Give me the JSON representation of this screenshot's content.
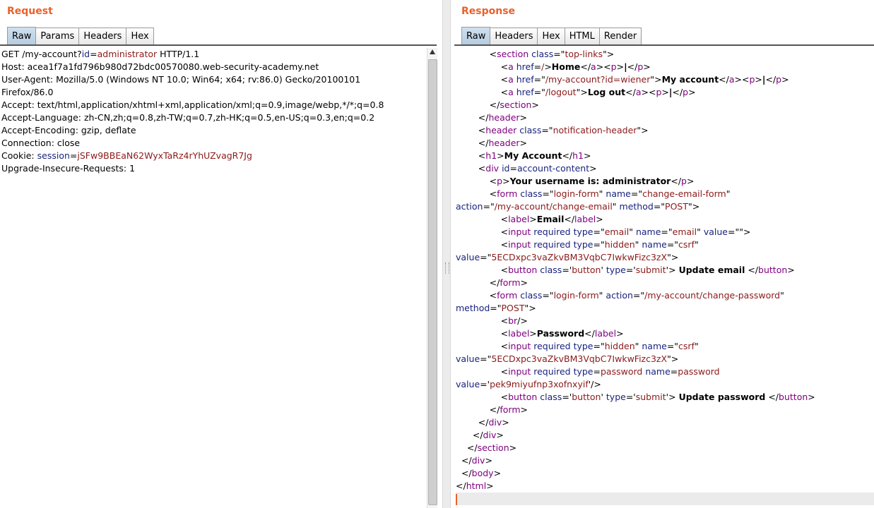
{
  "request": {
    "title": "Request",
    "tabs": [
      "Raw",
      "Params",
      "Headers",
      "Hex"
    ],
    "active_tab": "Raw",
    "lines": [
      [
        {
          "t": "GET /my-account?"
        },
        {
          "t": "id",
          "c": "attr"
        },
        {
          "t": "="
        },
        {
          "t": "administrator",
          "c": "val"
        },
        {
          "t": " HTTP/1.1"
        }
      ],
      [
        {
          "t": "Host: acea1f7a1fd796b980d72bdc00570080.web-security-academy.net"
        }
      ],
      [
        {
          "t": "User-Agent: Mozilla/5.0 (Windows NT 10.0; Win64; x64; rv:86.0) Gecko/20100101"
        }
      ],
      [
        {
          "t": "Firefox/86.0"
        }
      ],
      [
        {
          "t": "Accept: text/html,application/xhtml+xml,application/xml;q=0.9,image/webp,*/*;q=0.8"
        }
      ],
      [
        {
          "t": "Accept-Language: zh-CN,zh;q=0.8,zh-TW;q=0.7,zh-HK;q=0.5,en-US;q=0.3,en;q=0.2"
        }
      ],
      [
        {
          "t": "Accept-Encoding: gzip, deflate"
        }
      ],
      [
        {
          "t": "Connection: close"
        }
      ],
      [
        {
          "t": "Cookie: "
        },
        {
          "t": "session",
          "c": "attr"
        },
        {
          "t": "="
        },
        {
          "t": "jSFw9BBEaN62WyxTaRz4rYhUZvagR7Jg",
          "c": "val"
        }
      ],
      [
        {
          "t": "Upgrade-Insecure-Requests: 1"
        }
      ]
    ]
  },
  "response": {
    "title": "Response",
    "tabs": [
      "Raw",
      "Headers",
      "Hex",
      "HTML",
      "Render"
    ],
    "active_tab": "Raw",
    "lines": [
      [
        {
          "t": "            <"
        },
        {
          "t": "section",
          "c": "tag"
        },
        {
          "t": " "
        },
        {
          "t": "class",
          "c": "attr"
        },
        {
          "t": "=\""
        },
        {
          "t": "top-links",
          "c": "val"
        },
        {
          "t": "\">"
        }
      ],
      [
        {
          "t": "                <"
        },
        {
          "t": "a",
          "c": "tag"
        },
        {
          "t": " "
        },
        {
          "t": "href",
          "c": "attr"
        },
        {
          "t": "="
        },
        {
          "t": "/",
          "c": "val"
        },
        {
          "t": ">"
        },
        {
          "t": "Home",
          "c": "bold"
        },
        {
          "t": "</"
        },
        {
          "t": "a",
          "c": "tag"
        },
        {
          "t": "><"
        },
        {
          "t": "p",
          "c": "tag"
        },
        {
          "t": ">"
        },
        {
          "t": "|",
          "c": "bold"
        },
        {
          "t": "</"
        },
        {
          "t": "p",
          "c": "tag"
        },
        {
          "t": ">"
        }
      ],
      [
        {
          "t": "                <"
        },
        {
          "t": "a",
          "c": "tag"
        },
        {
          "t": " "
        },
        {
          "t": "href",
          "c": "attr"
        },
        {
          "t": "=\""
        },
        {
          "t": "/my-account?id=wiener",
          "c": "val"
        },
        {
          "t": "\">"
        },
        {
          "t": "My account",
          "c": "bold"
        },
        {
          "t": "</"
        },
        {
          "t": "a",
          "c": "tag"
        },
        {
          "t": "><"
        },
        {
          "t": "p",
          "c": "tag"
        },
        {
          "t": ">"
        },
        {
          "t": "|",
          "c": "bold"
        },
        {
          "t": "</"
        },
        {
          "t": "p",
          "c": "tag"
        },
        {
          "t": ">"
        }
      ],
      [
        {
          "t": "                <"
        },
        {
          "t": "a",
          "c": "tag"
        },
        {
          "t": " "
        },
        {
          "t": "href",
          "c": "attr"
        },
        {
          "t": "=\""
        },
        {
          "t": "/logout",
          "c": "val"
        },
        {
          "t": "\">"
        },
        {
          "t": "Log out",
          "c": "bold"
        },
        {
          "t": "</"
        },
        {
          "t": "a",
          "c": "tag"
        },
        {
          "t": "><"
        },
        {
          "t": "p",
          "c": "tag"
        },
        {
          "t": ">"
        },
        {
          "t": "|",
          "c": "bold"
        },
        {
          "t": "</"
        },
        {
          "t": "p",
          "c": "tag"
        },
        {
          "t": ">"
        }
      ],
      [
        {
          "t": "            </"
        },
        {
          "t": "section",
          "c": "tag"
        },
        {
          "t": ">"
        }
      ],
      [
        {
          "t": "        </"
        },
        {
          "t": "header",
          "c": "tag"
        },
        {
          "t": ">"
        }
      ],
      [
        {
          "t": "        <"
        },
        {
          "t": "header",
          "c": "tag"
        },
        {
          "t": " "
        },
        {
          "t": "class",
          "c": "attr"
        },
        {
          "t": "=\""
        },
        {
          "t": "notification-header",
          "c": "val"
        },
        {
          "t": "\">"
        }
      ],
      [
        {
          "t": "        </"
        },
        {
          "t": "header",
          "c": "tag"
        },
        {
          "t": ">"
        }
      ],
      [
        {
          "t": "        <"
        },
        {
          "t": "h1",
          "c": "tag"
        },
        {
          "t": ">"
        },
        {
          "t": "My Account",
          "c": "bold"
        },
        {
          "t": "</"
        },
        {
          "t": "h1",
          "c": "tag"
        },
        {
          "t": ">"
        }
      ],
      [
        {
          "t": "        <"
        },
        {
          "t": "div",
          "c": "tag"
        },
        {
          "t": " "
        },
        {
          "t": "id",
          "c": "attr"
        },
        {
          "t": "="
        },
        {
          "t": "account-content",
          "c": "attr"
        },
        {
          "t": ">"
        }
      ],
      [
        {
          "t": "            <"
        },
        {
          "t": "p",
          "c": "tag"
        },
        {
          "t": ">"
        },
        {
          "t": "Your username is: administrator",
          "c": "bold"
        },
        {
          "t": "</"
        },
        {
          "t": "p",
          "c": "tag"
        },
        {
          "t": ">"
        }
      ],
      [
        {
          "t": "            <"
        },
        {
          "t": "form",
          "c": "tag"
        },
        {
          "t": " "
        },
        {
          "t": "class",
          "c": "attr"
        },
        {
          "t": "=\""
        },
        {
          "t": "login-form",
          "c": "val"
        },
        {
          "t": "\" "
        },
        {
          "t": "name",
          "c": "attr"
        },
        {
          "t": "=\""
        },
        {
          "t": "change-email-form",
          "c": "val"
        },
        {
          "t": "\""
        }
      ],
      [
        {
          "t": "action",
          "c": "attr"
        },
        {
          "t": "=\""
        },
        {
          "t": "/my-account/change-email",
          "c": "val"
        },
        {
          "t": "\" "
        },
        {
          "t": "method",
          "c": "attr"
        },
        {
          "t": "=\""
        },
        {
          "t": "POST",
          "c": "val"
        },
        {
          "t": "\">"
        }
      ],
      [
        {
          "t": "                <"
        },
        {
          "t": "label",
          "c": "tag"
        },
        {
          "t": ">"
        },
        {
          "t": "Email",
          "c": "bold"
        },
        {
          "t": "</"
        },
        {
          "t": "label",
          "c": "tag"
        },
        {
          "t": ">"
        }
      ],
      [
        {
          "t": "                <"
        },
        {
          "t": "input",
          "c": "tag"
        },
        {
          "t": " "
        },
        {
          "t": "required",
          "c": "attr"
        },
        {
          "t": " "
        },
        {
          "t": "type",
          "c": "attr"
        },
        {
          "t": "=\""
        },
        {
          "t": "email",
          "c": "val"
        },
        {
          "t": "\" "
        },
        {
          "t": "name",
          "c": "attr"
        },
        {
          "t": "=\""
        },
        {
          "t": "email",
          "c": "val"
        },
        {
          "t": "\" "
        },
        {
          "t": "value",
          "c": "attr"
        },
        {
          "t": "=\"\">"
        }
      ],
      [
        {
          "t": "                <"
        },
        {
          "t": "input",
          "c": "tag"
        },
        {
          "t": " "
        },
        {
          "t": "required",
          "c": "attr"
        },
        {
          "t": " "
        },
        {
          "t": "type",
          "c": "attr"
        },
        {
          "t": "=\""
        },
        {
          "t": "hidden",
          "c": "val"
        },
        {
          "t": "\" "
        },
        {
          "t": "name",
          "c": "attr"
        },
        {
          "t": "=\""
        },
        {
          "t": "csrf",
          "c": "val"
        },
        {
          "t": "\""
        }
      ],
      [
        {
          "t": "value",
          "c": "attr"
        },
        {
          "t": "=\""
        },
        {
          "t": "5ECDxpc3vaZkvBM3VqbC7IwkwFizc3zX",
          "c": "val"
        },
        {
          "t": "\">"
        }
      ],
      [
        {
          "t": "                <"
        },
        {
          "t": "button",
          "c": "tag"
        },
        {
          "t": " "
        },
        {
          "t": "class",
          "c": "attr"
        },
        {
          "t": "='"
        },
        {
          "t": "button",
          "c": "val"
        },
        {
          "t": "' "
        },
        {
          "t": "type",
          "c": "attr"
        },
        {
          "t": "='"
        },
        {
          "t": "submit",
          "c": "val"
        },
        {
          "t": "'> "
        },
        {
          "t": "Update email",
          "c": "bold"
        },
        {
          "t": " </"
        },
        {
          "t": "button",
          "c": "tag"
        },
        {
          "t": ">"
        }
      ],
      [
        {
          "t": "            </"
        },
        {
          "t": "form",
          "c": "tag"
        },
        {
          "t": ">"
        }
      ],
      [
        {
          "t": "            <"
        },
        {
          "t": "form",
          "c": "tag"
        },
        {
          "t": " "
        },
        {
          "t": "class",
          "c": "attr"
        },
        {
          "t": "=\""
        },
        {
          "t": "login-form",
          "c": "val"
        },
        {
          "t": "\" "
        },
        {
          "t": "action",
          "c": "attr"
        },
        {
          "t": "=\""
        },
        {
          "t": "/my-account/change-password",
          "c": "val"
        },
        {
          "t": "\""
        }
      ],
      [
        {
          "t": "method",
          "c": "attr"
        },
        {
          "t": "=\""
        },
        {
          "t": "POST",
          "c": "val"
        },
        {
          "t": "\">"
        }
      ],
      [
        {
          "t": "                <"
        },
        {
          "t": "br",
          "c": "tag"
        },
        {
          "t": "/>"
        }
      ],
      [
        {
          "t": "                <"
        },
        {
          "t": "label",
          "c": "tag"
        },
        {
          "t": ">"
        },
        {
          "t": "Password",
          "c": "bold"
        },
        {
          "t": "</"
        },
        {
          "t": "label",
          "c": "tag"
        },
        {
          "t": ">"
        }
      ],
      [
        {
          "t": "                <"
        },
        {
          "t": "input",
          "c": "tag"
        },
        {
          "t": " "
        },
        {
          "t": "required",
          "c": "attr"
        },
        {
          "t": " "
        },
        {
          "t": "type",
          "c": "attr"
        },
        {
          "t": "=\""
        },
        {
          "t": "hidden",
          "c": "val"
        },
        {
          "t": "\" "
        },
        {
          "t": "name",
          "c": "attr"
        },
        {
          "t": "=\""
        },
        {
          "t": "csrf",
          "c": "val"
        },
        {
          "t": "\""
        }
      ],
      [
        {
          "t": "value",
          "c": "attr"
        },
        {
          "t": "=\""
        },
        {
          "t": "5ECDxpc3vaZkvBM3VqbC7IwkwFizc3zX",
          "c": "val"
        },
        {
          "t": "\">"
        }
      ],
      [
        {
          "t": "                <"
        },
        {
          "t": "input",
          "c": "tag"
        },
        {
          "t": " "
        },
        {
          "t": "required",
          "c": "attr"
        },
        {
          "t": " "
        },
        {
          "t": "type",
          "c": "attr"
        },
        {
          "t": "="
        },
        {
          "t": "password",
          "c": "val"
        },
        {
          "t": " "
        },
        {
          "t": "name",
          "c": "attr"
        },
        {
          "t": "="
        },
        {
          "t": "password",
          "c": "val"
        }
      ],
      [
        {
          "t": "value",
          "c": "attr"
        },
        {
          "t": "='"
        },
        {
          "t": "pek9miyufnp3xofnxyif",
          "c": "val"
        },
        {
          "t": "'/>"
        }
      ],
      [
        {
          "t": "                <"
        },
        {
          "t": "button",
          "c": "tag"
        },
        {
          "t": " "
        },
        {
          "t": "class",
          "c": "attr"
        },
        {
          "t": "='"
        },
        {
          "t": "button",
          "c": "val"
        },
        {
          "t": "' "
        },
        {
          "t": "type",
          "c": "attr"
        },
        {
          "t": "='"
        },
        {
          "t": "submit",
          "c": "val"
        },
        {
          "t": "'> "
        },
        {
          "t": "Update password",
          "c": "bold"
        },
        {
          "t": " </"
        },
        {
          "t": "button",
          "c": "tag"
        },
        {
          "t": ">"
        }
      ],
      [
        {
          "t": "            </"
        },
        {
          "t": "form",
          "c": "tag"
        },
        {
          "t": ">"
        }
      ],
      [
        {
          "t": "        </"
        },
        {
          "t": "div",
          "c": "tag"
        },
        {
          "t": ">"
        }
      ],
      [
        {
          "t": "      </"
        },
        {
          "t": "div",
          "c": "tag"
        },
        {
          "t": ">"
        }
      ],
      [
        {
          "t": "    </"
        },
        {
          "t": "section",
          "c": "tag"
        },
        {
          "t": ">"
        }
      ],
      [
        {
          "t": "  </"
        },
        {
          "t": "div",
          "c": "tag"
        },
        {
          "t": ">"
        }
      ],
      [
        {
          "t": "  </"
        },
        {
          "t": "body",
          "c": "tag"
        },
        {
          "t": ">"
        }
      ],
      [
        {
          "t": "</"
        },
        {
          "t": "html",
          "c": "tag"
        },
        {
          "t": ">"
        }
      ],
      []
    ]
  },
  "colors": {
    "title_orange": "#e8622a",
    "tag_purple": "#800080",
    "attr_navy": "#1a237e",
    "value_maroon": "#8b1a1a"
  }
}
